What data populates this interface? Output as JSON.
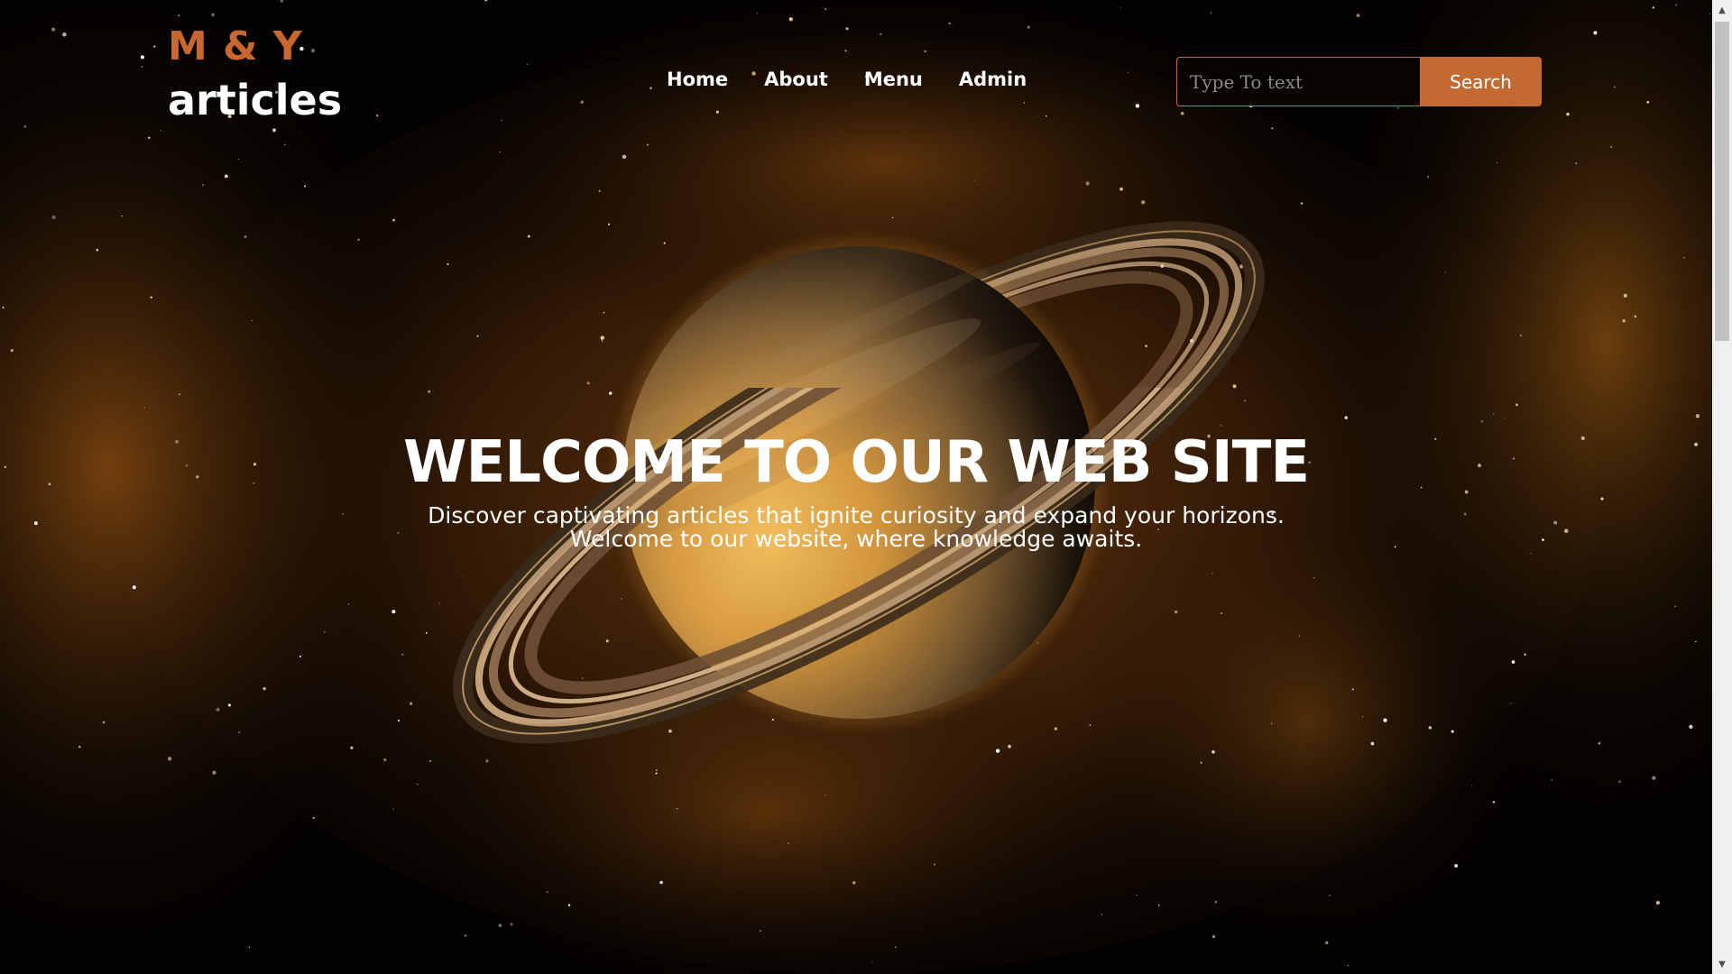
{
  "header": {
    "logo_line1": "M & Y",
    "logo_line2": "articles"
  },
  "nav": {
    "items": [
      {
        "label": "Home"
      },
      {
        "label": "About"
      },
      {
        "label": "Menu"
      },
      {
        "label": "Admin"
      }
    ]
  },
  "search": {
    "placeholder": "Type To text",
    "value": "",
    "button_label": "Search"
  },
  "hero": {
    "title": "WELCOME TO OUR WEB SITE",
    "subtitle_line1": "Discover captivating articles that ignite curiosity and expand your horizons.",
    "subtitle_line2": "Welcome to our website, where knowledge awaits."
  },
  "theme": {
    "accent": "#c26a32",
    "text": "#ffffff",
    "background": "#000000"
  },
  "icons": {
    "scroll_up": "arrow-up-icon",
    "scroll_down": "arrow-down-icon"
  }
}
